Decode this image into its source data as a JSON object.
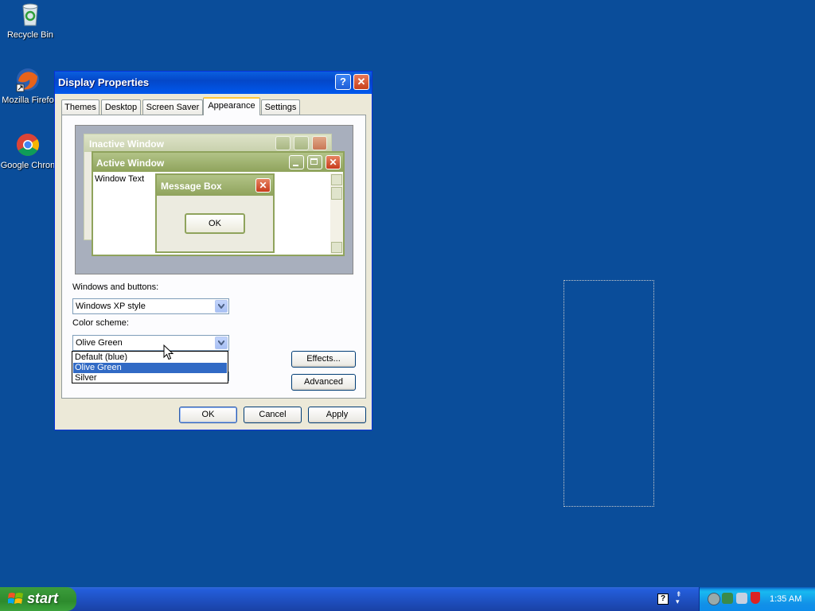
{
  "desktop": {
    "icons": [
      {
        "label": "Recycle Bin",
        "icon": "recycle-bin-icon"
      },
      {
        "label": "Mozilla Firefo",
        "icon": "firefox-icon"
      },
      {
        "label": "Google Chron",
        "icon": "chrome-icon"
      }
    ]
  },
  "window": {
    "title": "Display Properties",
    "help_label": "?",
    "tabs": [
      {
        "label": "Themes"
      },
      {
        "label": "Desktop"
      },
      {
        "label": "Screen Saver"
      },
      {
        "label": "Appearance",
        "active": true
      },
      {
        "label": "Settings"
      }
    ],
    "preview": {
      "inactive_title": "Inactive Window",
      "active_title": "Active Window",
      "window_text": "Window Text",
      "message_box_title": "Message Box",
      "ok_label": "OK"
    },
    "windows_buttons": {
      "label": "Windows and buttons:",
      "value": "Windows XP style"
    },
    "color_scheme": {
      "label": "Color scheme:",
      "value": "Olive Green",
      "options": [
        "Default (blue)",
        "Olive Green",
        "Silver"
      ],
      "selected_index": 1
    },
    "effects_label": "Effects...",
    "advanced_label": "Advanced",
    "ok_label": "OK",
    "cancel_label": "Cancel",
    "apply_label": "Apply"
  },
  "taskbar": {
    "start_label": "start",
    "clock": "1:35 AM"
  },
  "colors": {
    "desktop_bg": "#0a4d9a",
    "title_blue": "#0447c8",
    "olive_accent": "#8fa35c",
    "selection": "#316ac5"
  }
}
